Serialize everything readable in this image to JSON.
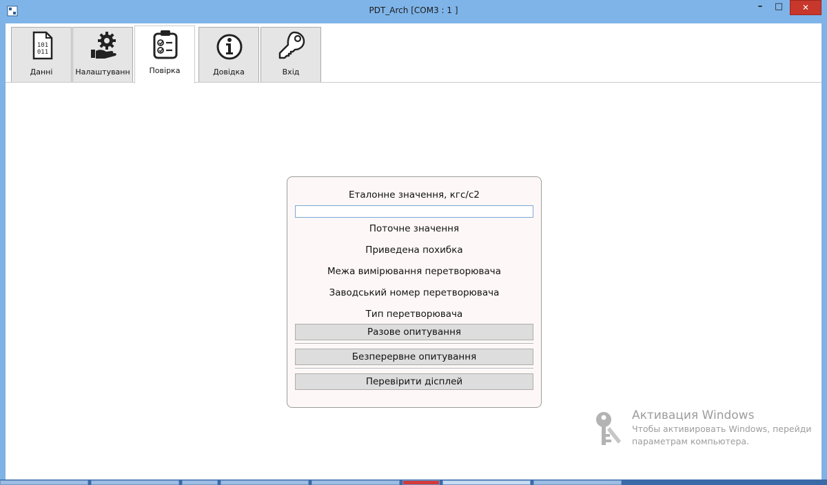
{
  "window": {
    "title": "PDT_Arch [COM3 : 1 ]",
    "min_symbol": "–",
    "max_symbol": "□",
    "close_symbol": "✕"
  },
  "tabs": [
    {
      "label": "Данні",
      "icon": "binary-data-icon"
    },
    {
      "label": "Налаштуванн",
      "icon": "gear-hand-icon"
    },
    {
      "label": "Повірка",
      "icon": "clipboard-check-icon",
      "active": true
    },
    {
      "label": "Довідка",
      "icon": "info-icon"
    },
    {
      "label": "Вхід",
      "icon": "key-icon"
    }
  ],
  "panel": {
    "reference_label": "Еталонне значення, кгс/с2",
    "reference_value": "",
    "current_value_label": "Поточне значення",
    "reduced_error_label": "Приведена похибка",
    "measurement_limit_label": "Межа вимірювання перетворювача",
    "serial_number_label": "Заводський номер перетворювача",
    "converter_type_label": "Тип перетворювача",
    "single_poll_button": "Разове опитування",
    "continuous_poll_button": "Безперервне опитування",
    "check_display_button": "Перевірити дісплей"
  },
  "watermark": {
    "title": "Активация Windows",
    "line1": "Чтобы активировать Windows, перейди",
    "line2": "параметрам компьютера."
  },
  "colors": {
    "titlebar": "#7fb4e8",
    "close_button": "#c8372b",
    "panel_background": "#fdf8f7",
    "button_background": "#dddddd"
  }
}
